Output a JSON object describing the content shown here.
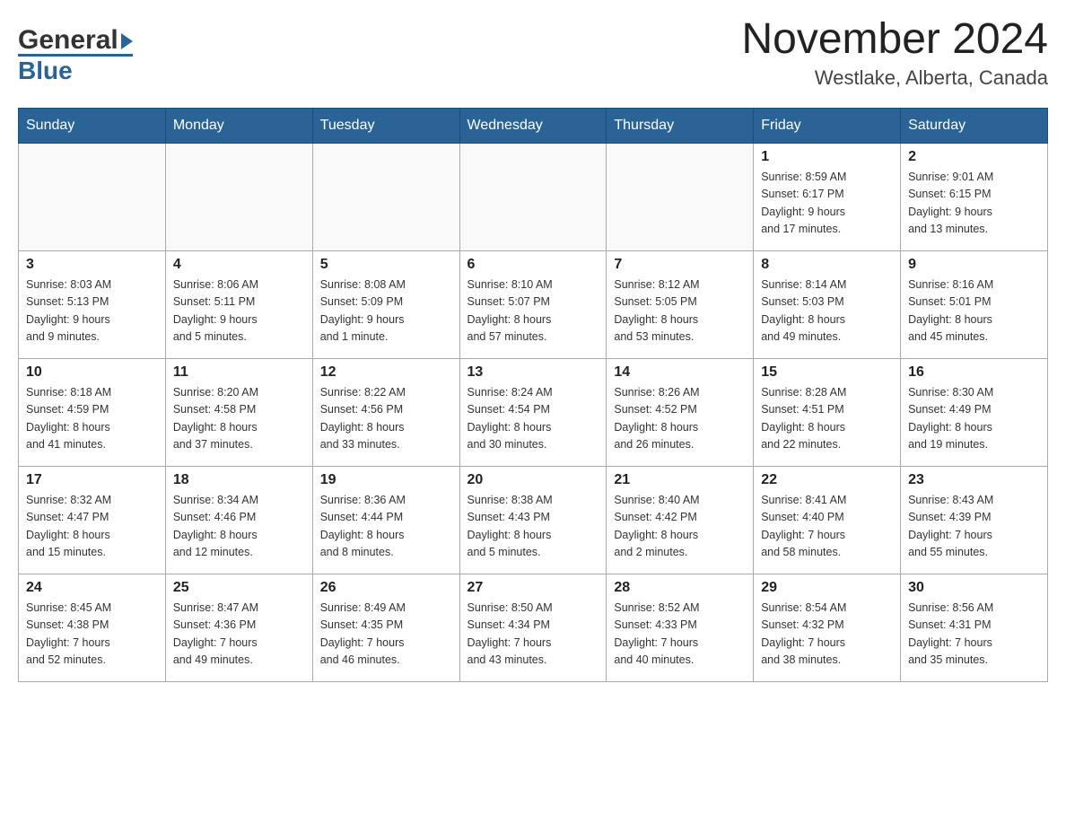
{
  "header": {
    "month_title": "November 2024",
    "location": "Westlake, Alberta, Canada",
    "logo_general": "General",
    "logo_blue": "Blue"
  },
  "days_of_week": [
    "Sunday",
    "Monday",
    "Tuesday",
    "Wednesday",
    "Thursday",
    "Friday",
    "Saturday"
  ],
  "weeks": [
    [
      {
        "day": "",
        "info": ""
      },
      {
        "day": "",
        "info": ""
      },
      {
        "day": "",
        "info": ""
      },
      {
        "day": "",
        "info": ""
      },
      {
        "day": "",
        "info": ""
      },
      {
        "day": "1",
        "info": "Sunrise: 8:59 AM\nSunset: 6:17 PM\nDaylight: 9 hours\nand 17 minutes."
      },
      {
        "day": "2",
        "info": "Sunrise: 9:01 AM\nSunset: 6:15 PM\nDaylight: 9 hours\nand 13 minutes."
      }
    ],
    [
      {
        "day": "3",
        "info": "Sunrise: 8:03 AM\nSunset: 5:13 PM\nDaylight: 9 hours\nand 9 minutes."
      },
      {
        "day": "4",
        "info": "Sunrise: 8:06 AM\nSunset: 5:11 PM\nDaylight: 9 hours\nand 5 minutes."
      },
      {
        "day": "5",
        "info": "Sunrise: 8:08 AM\nSunset: 5:09 PM\nDaylight: 9 hours\nand 1 minute."
      },
      {
        "day": "6",
        "info": "Sunrise: 8:10 AM\nSunset: 5:07 PM\nDaylight: 8 hours\nand 57 minutes."
      },
      {
        "day": "7",
        "info": "Sunrise: 8:12 AM\nSunset: 5:05 PM\nDaylight: 8 hours\nand 53 minutes."
      },
      {
        "day": "8",
        "info": "Sunrise: 8:14 AM\nSunset: 5:03 PM\nDaylight: 8 hours\nand 49 minutes."
      },
      {
        "day": "9",
        "info": "Sunrise: 8:16 AM\nSunset: 5:01 PM\nDaylight: 8 hours\nand 45 minutes."
      }
    ],
    [
      {
        "day": "10",
        "info": "Sunrise: 8:18 AM\nSunset: 4:59 PM\nDaylight: 8 hours\nand 41 minutes."
      },
      {
        "day": "11",
        "info": "Sunrise: 8:20 AM\nSunset: 4:58 PM\nDaylight: 8 hours\nand 37 minutes."
      },
      {
        "day": "12",
        "info": "Sunrise: 8:22 AM\nSunset: 4:56 PM\nDaylight: 8 hours\nand 33 minutes."
      },
      {
        "day": "13",
        "info": "Sunrise: 8:24 AM\nSunset: 4:54 PM\nDaylight: 8 hours\nand 30 minutes."
      },
      {
        "day": "14",
        "info": "Sunrise: 8:26 AM\nSunset: 4:52 PM\nDaylight: 8 hours\nand 26 minutes."
      },
      {
        "day": "15",
        "info": "Sunrise: 8:28 AM\nSunset: 4:51 PM\nDaylight: 8 hours\nand 22 minutes."
      },
      {
        "day": "16",
        "info": "Sunrise: 8:30 AM\nSunset: 4:49 PM\nDaylight: 8 hours\nand 19 minutes."
      }
    ],
    [
      {
        "day": "17",
        "info": "Sunrise: 8:32 AM\nSunset: 4:47 PM\nDaylight: 8 hours\nand 15 minutes."
      },
      {
        "day": "18",
        "info": "Sunrise: 8:34 AM\nSunset: 4:46 PM\nDaylight: 8 hours\nand 12 minutes."
      },
      {
        "day": "19",
        "info": "Sunrise: 8:36 AM\nSunset: 4:44 PM\nDaylight: 8 hours\nand 8 minutes."
      },
      {
        "day": "20",
        "info": "Sunrise: 8:38 AM\nSunset: 4:43 PM\nDaylight: 8 hours\nand 5 minutes."
      },
      {
        "day": "21",
        "info": "Sunrise: 8:40 AM\nSunset: 4:42 PM\nDaylight: 8 hours\nand 2 minutes."
      },
      {
        "day": "22",
        "info": "Sunrise: 8:41 AM\nSunset: 4:40 PM\nDaylight: 7 hours\nand 58 minutes."
      },
      {
        "day": "23",
        "info": "Sunrise: 8:43 AM\nSunset: 4:39 PM\nDaylight: 7 hours\nand 55 minutes."
      }
    ],
    [
      {
        "day": "24",
        "info": "Sunrise: 8:45 AM\nSunset: 4:38 PM\nDaylight: 7 hours\nand 52 minutes."
      },
      {
        "day": "25",
        "info": "Sunrise: 8:47 AM\nSunset: 4:36 PM\nDaylight: 7 hours\nand 49 minutes."
      },
      {
        "day": "26",
        "info": "Sunrise: 8:49 AM\nSunset: 4:35 PM\nDaylight: 7 hours\nand 46 minutes."
      },
      {
        "day": "27",
        "info": "Sunrise: 8:50 AM\nSunset: 4:34 PM\nDaylight: 7 hours\nand 43 minutes."
      },
      {
        "day": "28",
        "info": "Sunrise: 8:52 AM\nSunset: 4:33 PM\nDaylight: 7 hours\nand 40 minutes."
      },
      {
        "day": "29",
        "info": "Sunrise: 8:54 AM\nSunset: 4:32 PM\nDaylight: 7 hours\nand 38 minutes."
      },
      {
        "day": "30",
        "info": "Sunrise: 8:56 AM\nSunset: 4:31 PM\nDaylight: 7 hours\nand 35 minutes."
      }
    ]
  ]
}
